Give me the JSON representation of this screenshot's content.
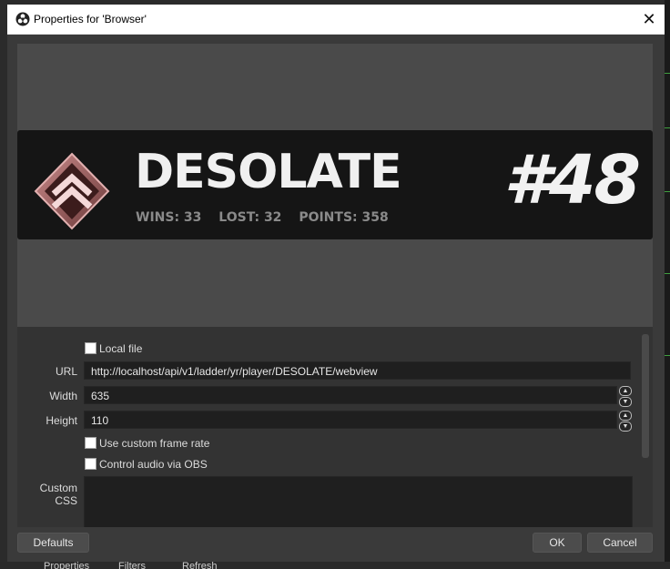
{
  "window": {
    "title": "Properties for 'Browser'",
    "close_symbol": "✕"
  },
  "preview": {
    "player_name": "DESOLATE",
    "rank": "#48",
    "stats": {
      "wins": "WINS: 33",
      "lost": "LOST: 32",
      "points": "POINTS: 358"
    }
  },
  "properties": {
    "local_file_label": "Local file",
    "url_label": "URL",
    "url_value": "http://localhost/api/v1/ladder/yr/player/DESOLATE/webview",
    "width_label": "Width",
    "width_value": "635",
    "height_label": "Height",
    "height_value": "110",
    "custom_frame_rate_label": "Use custom frame rate",
    "control_audio_label": "Control audio via OBS",
    "custom_css_label": "Custom CSS"
  },
  "buttons": {
    "defaults": "Defaults",
    "ok": "OK",
    "cancel": "Cancel"
  },
  "background_fragments": {
    "properties": "Properties",
    "filters": "Filters",
    "refresh": "Refresh"
  },
  "icons": {
    "app": "obs-icon",
    "close": "close-icon",
    "emblem": "rank-chevron-emblem-icon",
    "spin_up": "chevron-up-icon",
    "spin_down": "chevron-down-icon"
  }
}
